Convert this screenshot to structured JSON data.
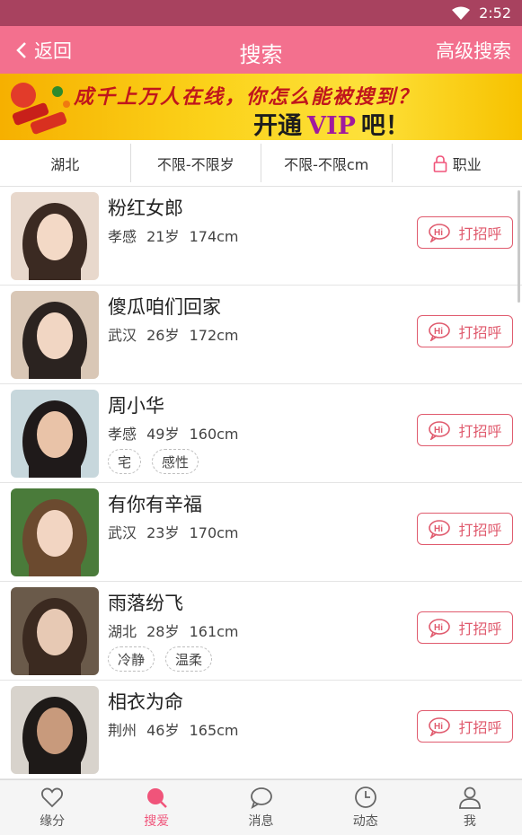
{
  "status_bar": {
    "time": "2:52",
    "wifi_icon": "wifi-icon"
  },
  "header": {
    "back_label": "返回",
    "title": "搜索",
    "advanced_label": "高级搜索"
  },
  "banner": {
    "line1": "成千上万人在线，你怎么能被搜到？",
    "line2_prefix": "开通",
    "line2_vip": "VIP",
    "line2_suffix": "吧！"
  },
  "filters": {
    "region": "湖北",
    "age": "不限-不限岁",
    "height": "不限-不限cm",
    "job": "职业"
  },
  "hi_label": "打招呼",
  "users": [
    {
      "name": "粉红女郎",
      "city": "孝感",
      "age": "21岁",
      "height": "174cm",
      "tags": []
    },
    {
      "name": "傻瓜咱们回家",
      "city": "武汉",
      "age": "26岁",
      "height": "172cm",
      "tags": []
    },
    {
      "name": "周小华",
      "city": "孝感",
      "age": "49岁",
      "height": "160cm",
      "tags": [
        "宅",
        "感性"
      ]
    },
    {
      "name": "有你有辛福",
      "city": "武汉",
      "age": "23岁",
      "height": "170cm",
      "tags": []
    },
    {
      "name": "雨落纷飞",
      "city": "湖北",
      "age": "28岁",
      "height": "161cm",
      "tags": [
        "冷静",
        "温柔"
      ]
    },
    {
      "name": "相衣为命",
      "city": "荆州",
      "age": "46岁",
      "height": "165cm",
      "tags": []
    }
  ],
  "nav": [
    {
      "label": "缘分",
      "icon": "heart-icon",
      "active": false
    },
    {
      "label": "搜爱",
      "icon": "search-icon",
      "active": true
    },
    {
      "label": "消息",
      "icon": "chat-bubble-icon",
      "active": false
    },
    {
      "label": "动态",
      "icon": "clock-icon",
      "active": false
    },
    {
      "label": "我",
      "icon": "person-icon",
      "active": false
    }
  ],
  "colors": {
    "header": "#f3708e",
    "status_bar": "#a8425f",
    "accent": "#f0547a",
    "hi_button": "#e05b6e"
  }
}
